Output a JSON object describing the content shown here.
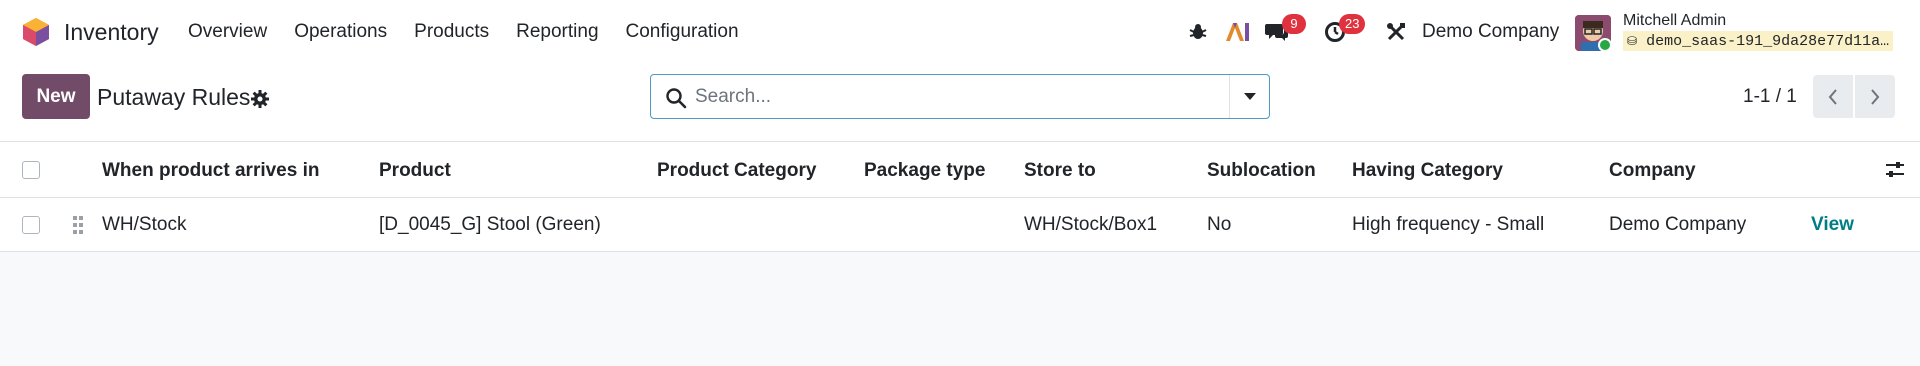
{
  "app": {
    "name": "Inventory",
    "logo_icon": "odoo-inventory-logo-icon"
  },
  "menu": [
    {
      "label": "Overview"
    },
    {
      "label": "Operations"
    },
    {
      "label": "Products"
    },
    {
      "label": "Reporting"
    },
    {
      "label": "Configuration"
    }
  ],
  "systray": {
    "debug_icon": "bug-icon",
    "ai_icon": "ai-icon",
    "messages_badge": "9",
    "activities_badge": "23",
    "settings_icon": "tools-icon",
    "company": "Demo Company",
    "user_name": "Mitchell Admin",
    "database": "demo_saas-191_9da28e77d11a…"
  },
  "control_panel": {
    "new_label": "New",
    "title": "Putaway Rules",
    "search_placeholder": "Search...",
    "pager": "1-1 / 1"
  },
  "table": {
    "columns": [
      "When product arrives in",
      "Product",
      "Product Category",
      "Package type",
      "Store to",
      "Sublocation",
      "Having Category",
      "Company"
    ],
    "rows": [
      {
        "location_in": "WH/Stock",
        "product": "[D_0045_G] Stool (Green)",
        "product_category": "",
        "package_type": "",
        "store_to": "WH/Stock/Box1",
        "sublocation": "No",
        "having_category": "High frequency - Small",
        "company": "Demo Company",
        "action": "View"
      }
    ]
  },
  "colors": {
    "brand": "#714b67",
    "link": "#017e84",
    "badge": "#e0313e"
  }
}
